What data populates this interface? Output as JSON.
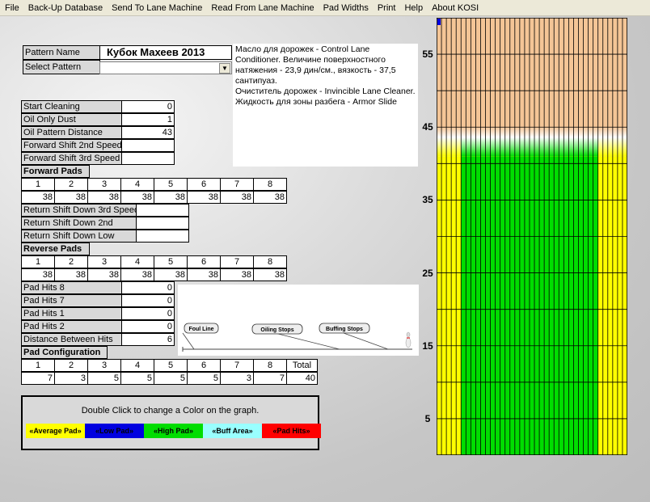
{
  "menu": [
    "File",
    "Back-Up Database",
    "Send To Lane Machine",
    "Read From Lane Machine",
    "Pad Widths",
    "Print",
    "Help",
    "About KOSI"
  ],
  "pattern": {
    "name_label": "Pattern Name",
    "name_value": "Кубок Махеев 2013",
    "select_label": "Select Pattern",
    "select_value": ""
  },
  "description": [
    "Масло для дорожек - Control Lane Conditioner. Величине поверхностного натяжения - 23,9 дин/см., вязкость - 37,5 сантипуаз.",
    "Очиститель дорожек - Invincible Lane Cleaner.",
    "Жидкость для зоны разбега - Armor Slide"
  ],
  "settings": [
    {
      "label": "Start Cleaning",
      "value": "0"
    },
    {
      "label": "Oil Only Dust",
      "value": "1"
    },
    {
      "label": "Oil Pattern Distance",
      "value": "43"
    },
    {
      "label": "Forward Shift 2nd Speed",
      "value": ""
    },
    {
      "label": "Forward Shift 3rd Speed",
      "value": ""
    }
  ],
  "forward_pads": {
    "title": "Forward Pads",
    "headers": [
      "1",
      "2",
      "3",
      "4",
      "5",
      "6",
      "7",
      "8"
    ],
    "values": [
      "38",
      "38",
      "38",
      "38",
      "38",
      "38",
      "38",
      "38"
    ]
  },
  "return_shift": [
    {
      "label": "Return Shift Down 3rd Speed",
      "value": ""
    },
    {
      "label": "Return Shift Down 2nd",
      "value": ""
    },
    {
      "label": "Return Shift Down Low",
      "value": ""
    }
  ],
  "reverse_pads": {
    "title": "Reverse Pads",
    "headers": [
      "1",
      "2",
      "3",
      "4",
      "5",
      "6",
      "7",
      "8"
    ],
    "values": [
      "38",
      "38",
      "38",
      "38",
      "38",
      "38",
      "38",
      "38"
    ]
  },
  "pad_hits": [
    {
      "label": "Pad Hits 8",
      "value": "0"
    },
    {
      "label": "Pad Hits 7",
      "value": "0"
    },
    {
      "label": "Pad Hits 1",
      "value": "0"
    },
    {
      "label": "Pad Hits 2",
      "value": "0"
    },
    {
      "label": "Distance Between Hits",
      "value": "6"
    }
  ],
  "lane_diagram": {
    "labels": [
      "Foul Line",
      "Oiling Stops",
      "Buffing Stops"
    ]
  },
  "pad_config": {
    "title": "Pad Configuration",
    "headers": [
      "1",
      "2",
      "3",
      "4",
      "5",
      "6",
      "7",
      "8",
      "Total"
    ],
    "values": [
      "7",
      "3",
      "5",
      "5",
      "5",
      "5",
      "3",
      "7",
      "40"
    ]
  },
  "legend": {
    "note": "Double Click  to change a Color on the graph.",
    "items": [
      {
        "label": "«Average Pad»",
        "color": "#ffff00",
        "text_color": "#000000"
      },
      {
        "label": "«Low Pad»",
        "color": "#0000e0",
        "text_color": "#000000"
      },
      {
        "label": "«High Pad»",
        "color": "#00dd00",
        "text_color": "#000000"
      },
      {
        "label": "«Buff Area»",
        "color": "#99ffff",
        "text_color": "#000000"
      },
      {
        "label": "«Pad Hits»",
        "color": "#ff0000",
        "text_color": "#000000"
      }
    ]
  },
  "lane_chart": {
    "y_ticks": [
      "55",
      "45",
      "35",
      "25",
      "15",
      "5"
    ],
    "y_range_ft": [
      0,
      60
    ],
    "oil_distance_ft": 43,
    "board_count": 39,
    "high_pad_boards": [
      6,
      33
    ],
    "colors": {
      "average": "#ffff00",
      "high": "#00dd00",
      "buff": "#f4c596",
      "grid": "#000000"
    }
  }
}
